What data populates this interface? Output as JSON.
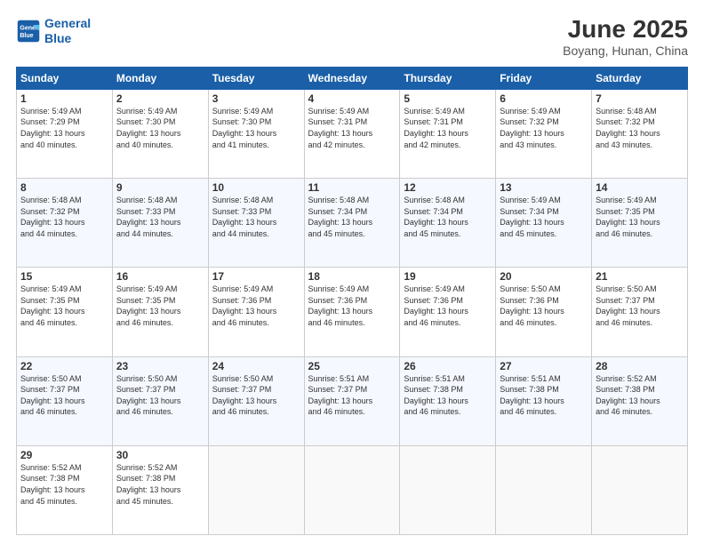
{
  "header": {
    "logo_line1": "General",
    "logo_line2": "Blue",
    "title": "June 2025",
    "subtitle": "Boyang, Hunan, China"
  },
  "columns": [
    "Sunday",
    "Monday",
    "Tuesday",
    "Wednesday",
    "Thursday",
    "Friday",
    "Saturday"
  ],
  "rows": [
    [
      {
        "day": "1",
        "lines": [
          "Sunrise: 5:49 AM",
          "Sunset: 7:29 PM",
          "Daylight: 13 hours",
          "and 40 minutes."
        ]
      },
      {
        "day": "2",
        "lines": [
          "Sunrise: 5:49 AM",
          "Sunset: 7:30 PM",
          "Daylight: 13 hours",
          "and 40 minutes."
        ]
      },
      {
        "day": "3",
        "lines": [
          "Sunrise: 5:49 AM",
          "Sunset: 7:30 PM",
          "Daylight: 13 hours",
          "and 41 minutes."
        ]
      },
      {
        "day": "4",
        "lines": [
          "Sunrise: 5:49 AM",
          "Sunset: 7:31 PM",
          "Daylight: 13 hours",
          "and 42 minutes."
        ]
      },
      {
        "day": "5",
        "lines": [
          "Sunrise: 5:49 AM",
          "Sunset: 7:31 PM",
          "Daylight: 13 hours",
          "and 42 minutes."
        ]
      },
      {
        "day": "6",
        "lines": [
          "Sunrise: 5:49 AM",
          "Sunset: 7:32 PM",
          "Daylight: 13 hours",
          "and 43 minutes."
        ]
      },
      {
        "day": "7",
        "lines": [
          "Sunrise: 5:48 AM",
          "Sunset: 7:32 PM",
          "Daylight: 13 hours",
          "and 43 minutes."
        ]
      }
    ],
    [
      {
        "day": "8",
        "lines": [
          "Sunrise: 5:48 AM",
          "Sunset: 7:32 PM",
          "Daylight: 13 hours",
          "and 44 minutes."
        ]
      },
      {
        "day": "9",
        "lines": [
          "Sunrise: 5:48 AM",
          "Sunset: 7:33 PM",
          "Daylight: 13 hours",
          "and 44 minutes."
        ]
      },
      {
        "day": "10",
        "lines": [
          "Sunrise: 5:48 AM",
          "Sunset: 7:33 PM",
          "Daylight: 13 hours",
          "and 44 minutes."
        ]
      },
      {
        "day": "11",
        "lines": [
          "Sunrise: 5:48 AM",
          "Sunset: 7:34 PM",
          "Daylight: 13 hours",
          "and 45 minutes."
        ]
      },
      {
        "day": "12",
        "lines": [
          "Sunrise: 5:48 AM",
          "Sunset: 7:34 PM",
          "Daylight: 13 hours",
          "and 45 minutes."
        ]
      },
      {
        "day": "13",
        "lines": [
          "Sunrise: 5:49 AM",
          "Sunset: 7:34 PM",
          "Daylight: 13 hours",
          "and 45 minutes."
        ]
      },
      {
        "day": "14",
        "lines": [
          "Sunrise: 5:49 AM",
          "Sunset: 7:35 PM",
          "Daylight: 13 hours",
          "and 46 minutes."
        ]
      }
    ],
    [
      {
        "day": "15",
        "lines": [
          "Sunrise: 5:49 AM",
          "Sunset: 7:35 PM",
          "Daylight: 13 hours",
          "and 46 minutes."
        ]
      },
      {
        "day": "16",
        "lines": [
          "Sunrise: 5:49 AM",
          "Sunset: 7:35 PM",
          "Daylight: 13 hours",
          "and 46 minutes."
        ]
      },
      {
        "day": "17",
        "lines": [
          "Sunrise: 5:49 AM",
          "Sunset: 7:36 PM",
          "Daylight: 13 hours",
          "and 46 minutes."
        ]
      },
      {
        "day": "18",
        "lines": [
          "Sunrise: 5:49 AM",
          "Sunset: 7:36 PM",
          "Daylight: 13 hours",
          "and 46 minutes."
        ]
      },
      {
        "day": "19",
        "lines": [
          "Sunrise: 5:49 AM",
          "Sunset: 7:36 PM",
          "Daylight: 13 hours",
          "and 46 minutes."
        ]
      },
      {
        "day": "20",
        "lines": [
          "Sunrise: 5:50 AM",
          "Sunset: 7:36 PM",
          "Daylight: 13 hours",
          "and 46 minutes."
        ]
      },
      {
        "day": "21",
        "lines": [
          "Sunrise: 5:50 AM",
          "Sunset: 7:37 PM",
          "Daylight: 13 hours",
          "and 46 minutes."
        ]
      }
    ],
    [
      {
        "day": "22",
        "lines": [
          "Sunrise: 5:50 AM",
          "Sunset: 7:37 PM",
          "Daylight: 13 hours",
          "and 46 minutes."
        ]
      },
      {
        "day": "23",
        "lines": [
          "Sunrise: 5:50 AM",
          "Sunset: 7:37 PM",
          "Daylight: 13 hours",
          "and 46 minutes."
        ]
      },
      {
        "day": "24",
        "lines": [
          "Sunrise: 5:50 AM",
          "Sunset: 7:37 PM",
          "Daylight: 13 hours",
          "and 46 minutes."
        ]
      },
      {
        "day": "25",
        "lines": [
          "Sunrise: 5:51 AM",
          "Sunset: 7:37 PM",
          "Daylight: 13 hours",
          "and 46 minutes."
        ]
      },
      {
        "day": "26",
        "lines": [
          "Sunrise: 5:51 AM",
          "Sunset: 7:38 PM",
          "Daylight: 13 hours",
          "and 46 minutes."
        ]
      },
      {
        "day": "27",
        "lines": [
          "Sunrise: 5:51 AM",
          "Sunset: 7:38 PM",
          "Daylight: 13 hours",
          "and 46 minutes."
        ]
      },
      {
        "day": "28",
        "lines": [
          "Sunrise: 5:52 AM",
          "Sunset: 7:38 PM",
          "Daylight: 13 hours",
          "and 46 minutes."
        ]
      }
    ],
    [
      {
        "day": "29",
        "lines": [
          "Sunrise: 5:52 AM",
          "Sunset: 7:38 PM",
          "Daylight: 13 hours",
          "and 45 minutes."
        ]
      },
      {
        "day": "30",
        "lines": [
          "Sunrise: 5:52 AM",
          "Sunset: 7:38 PM",
          "Daylight: 13 hours",
          "and 45 minutes."
        ]
      },
      {
        "day": "",
        "lines": []
      },
      {
        "day": "",
        "lines": []
      },
      {
        "day": "",
        "lines": []
      },
      {
        "day": "",
        "lines": []
      },
      {
        "day": "",
        "lines": []
      }
    ]
  ]
}
